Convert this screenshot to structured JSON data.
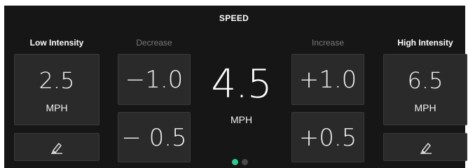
{
  "title": "SPEED",
  "low": {
    "label": "Low Intensity",
    "value": "2.5",
    "unit": "MPH"
  },
  "high": {
    "label": "High Intensity",
    "value": "6.5",
    "unit": "MPH"
  },
  "decrease": {
    "label": "Decrease",
    "steps": [
      "−1.0",
      "− 0.5"
    ]
  },
  "increase": {
    "label": "Increase",
    "steps": [
      "+1.0",
      "+0.5"
    ]
  },
  "current": {
    "value": "4.5",
    "unit": "MPH"
  },
  "pager": {
    "pages": 2,
    "active": 0
  },
  "colors": {
    "accent": "#2ecc8f",
    "background": "#161616",
    "tile": "#2a2a2a"
  }
}
